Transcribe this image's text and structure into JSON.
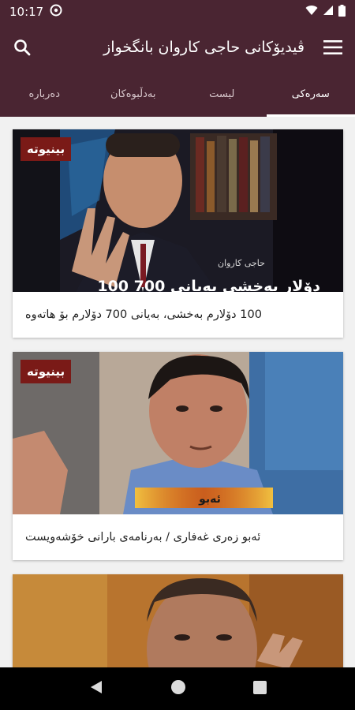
{
  "status_bar": {
    "time": "10:17"
  },
  "app_bar": {
    "title": "ڤیدیۆکانی حاجی کاروان بانگخواز",
    "menu_icon": "menu-icon",
    "search_icon": "search-icon"
  },
  "tabs": [
    {
      "label": "سەرەکی",
      "active": true
    },
    {
      "label": "لیست",
      "active": false
    },
    {
      "label": "بەدڵبوەکان",
      "active": false
    },
    {
      "label": "دەربارە",
      "active": false
    }
  ],
  "cards": [
    {
      "badge": "بینیوتە",
      "caption": "100 دۆلارم بەخشی، بەیانی 700 دۆلارم بۆ هاتەوە",
      "overlay_text": "100 دۆلار بەخشی بەیانی 700",
      "overlay_small": "حاجی کاروان"
    },
    {
      "badge": "بینیوتە",
      "caption": "ئەبو زەری غەفاری / بەرنامەی بارانی خۆشەویست",
      "overlay_text": "ئەبو"
    },
    {
      "badge": "",
      "caption": ""
    }
  ],
  "colors": {
    "primary": "#4a2532",
    "badge": "#7a1a17"
  }
}
